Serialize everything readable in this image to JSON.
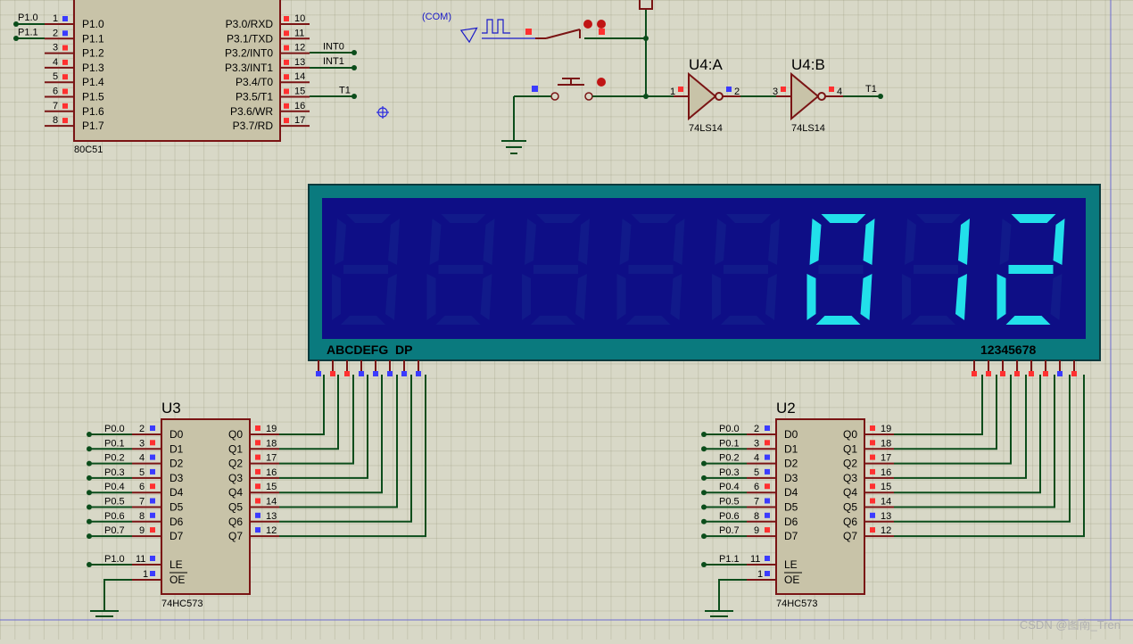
{
  "mcu": {
    "ref": "80C51",
    "left_pins": [
      {
        "num": "1",
        "name": "P1.0",
        "net": "P1.0"
      },
      {
        "num": "2",
        "name": "P1.1",
        "net": "P1.1"
      },
      {
        "num": "3",
        "name": "P1.2",
        "net": ""
      },
      {
        "num": "4",
        "name": "P1.3",
        "net": ""
      },
      {
        "num": "5",
        "name": "P1.4",
        "net": ""
      },
      {
        "num": "6",
        "name": "P1.5",
        "net": ""
      },
      {
        "num": "7",
        "name": "P1.6",
        "net": ""
      },
      {
        "num": "8",
        "name": "P1.7",
        "net": ""
      }
    ],
    "right_pins": [
      {
        "num": "10",
        "name": "P3.0/RXD",
        "net": ""
      },
      {
        "num": "11",
        "name": "P3.1/TXD",
        "net": ""
      },
      {
        "num": "12",
        "name": "P3.2/INT0",
        "net": "INT0"
      },
      {
        "num": "13",
        "name": "P3.3/INT1",
        "net": "INT1"
      },
      {
        "num": "14",
        "name": "P3.4/T0",
        "net": ""
      },
      {
        "num": "15",
        "name": "P3.5/T1",
        "net": "T1"
      },
      {
        "num": "16",
        "name": "P3.6/WR",
        "net": ""
      },
      {
        "num": "17",
        "name": "P3.7/RD",
        "net": ""
      }
    ]
  },
  "signal": {
    "com_label": "(COM)"
  },
  "gates": [
    {
      "ref": "U4:A",
      "part": "74LS14",
      "in_pin": "1",
      "out_pin": "2"
    },
    {
      "ref": "U4:B",
      "part": "74LS14",
      "in_pin": "3",
      "out_pin": "4"
    }
  ],
  "t1_label": "T1",
  "display": {
    "segments_label": "ABCDEFG  DP",
    "digits_label": "12345678",
    "digits": [
      "",
      "",
      "",
      "",
      "",
      "0",
      "1",
      "2"
    ]
  },
  "latches": [
    {
      "ref": "U3",
      "part": "74HC573",
      "le_net": "P1.0",
      "d_pins": [
        {
          "net": "P0.0",
          "num": "2",
          "name": "D0"
        },
        {
          "net": "P0.1",
          "num": "3",
          "name": "D1"
        },
        {
          "net": "P0.2",
          "num": "4",
          "name": "D2"
        },
        {
          "net": "P0.3",
          "num": "5",
          "name": "D3"
        },
        {
          "net": "P0.4",
          "num": "6",
          "name": "D4"
        },
        {
          "net": "P0.5",
          "num": "7",
          "name": "D5"
        },
        {
          "net": "P0.6",
          "num": "8",
          "name": "D6"
        },
        {
          "net": "P0.7",
          "num": "9",
          "name": "D7"
        }
      ],
      "q_pins": [
        {
          "num": "19",
          "name": "Q0"
        },
        {
          "num": "18",
          "name": "Q1"
        },
        {
          "num": "17",
          "name": "Q2"
        },
        {
          "num": "16",
          "name": "Q3"
        },
        {
          "num": "15",
          "name": "Q4"
        },
        {
          "num": "14",
          "name": "Q5"
        },
        {
          "num": "13",
          "name": "Q6"
        },
        {
          "num": "12",
          "name": "Q7"
        }
      ],
      "le": {
        "num": "11",
        "name": "LE"
      },
      "oe": {
        "num": "1",
        "name": "OE"
      }
    },
    {
      "ref": "U2",
      "part": "74HC573",
      "le_net": "P1.1",
      "d_pins": [
        {
          "net": "P0.0",
          "num": "2",
          "name": "D0"
        },
        {
          "net": "P0.1",
          "num": "3",
          "name": "D1"
        },
        {
          "net": "P0.2",
          "num": "4",
          "name": "D2"
        },
        {
          "net": "P0.3",
          "num": "5",
          "name": "D3"
        },
        {
          "net": "P0.4",
          "num": "6",
          "name": "D4"
        },
        {
          "net": "P0.5",
          "num": "7",
          "name": "D5"
        },
        {
          "net": "P0.6",
          "num": "8",
          "name": "D6"
        },
        {
          "net": "P0.7",
          "num": "9",
          "name": "D7"
        }
      ],
      "q_pins": [
        {
          "num": "19",
          "name": "Q0"
        },
        {
          "num": "18",
          "name": "Q1"
        },
        {
          "num": "17",
          "name": "Q2"
        },
        {
          "num": "16",
          "name": "Q3"
        },
        {
          "num": "15",
          "name": "Q4"
        },
        {
          "num": "14",
          "name": "Q5"
        },
        {
          "num": "13",
          "name": "Q6"
        },
        {
          "num": "12",
          "name": "Q7"
        }
      ],
      "le": {
        "num": "11",
        "name": "LE"
      },
      "oe": {
        "num": "1",
        "name": "OE"
      }
    }
  ],
  "watermark": "CSDN @图南_Tren"
}
